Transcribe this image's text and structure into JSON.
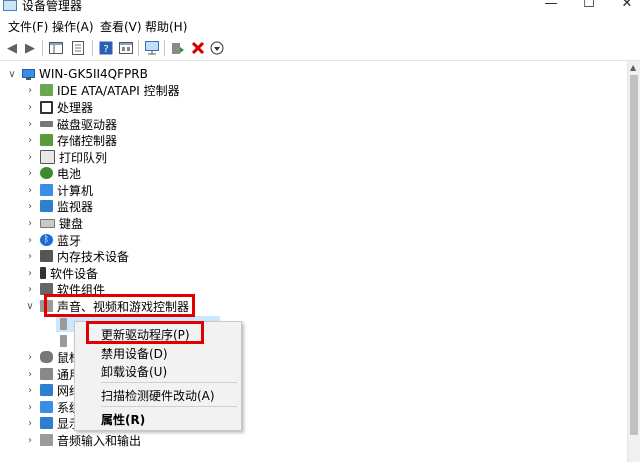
{
  "window": {
    "title": "设备管理器",
    "controls": {
      "minimize": "—",
      "maximize": "☐",
      "close": "✕"
    }
  },
  "menu": [
    "文件(F)",
    "操作(A)",
    "查看(V)",
    "帮助(H)"
  ],
  "tree": {
    "root": "WIN-GK5II4QFPRB",
    "categories": [
      {
        "label": "IDE ATA/ATAPI 控制器",
        "icon": "ide-controller-icon"
      },
      {
        "label": "处理器",
        "icon": "processor-icon"
      },
      {
        "label": "磁盘驱动器",
        "icon": "disk-drive-icon"
      },
      {
        "label": "存储控制器",
        "icon": "storage-controller-icon"
      },
      {
        "label": "打印队列",
        "icon": "printer-icon"
      },
      {
        "label": "电池",
        "icon": "battery-icon"
      },
      {
        "label": "计算机",
        "icon": "computer-icon"
      },
      {
        "label": "监视器",
        "icon": "monitor-icon"
      },
      {
        "label": "键盘",
        "icon": "keyboard-icon"
      },
      {
        "label": "蓝牙",
        "icon": "bluetooth-icon"
      },
      {
        "label": "内存技术设备",
        "icon": "memory-device-icon"
      },
      {
        "label": "软件设备",
        "icon": "software-device-icon"
      },
      {
        "label": "软件组件",
        "icon": "software-component-icon"
      },
      {
        "label": "声音、视频和游戏控制器",
        "icon": "sound-icon"
      }
    ],
    "after_categories": [
      {
        "label": "鼠标",
        "icon": "mouse-icon"
      },
      {
        "label": "通用",
        "icon": "usb-icon"
      },
      {
        "label": "网络",
        "icon": "network-icon"
      },
      {
        "label": "系统",
        "icon": "system-icon"
      },
      {
        "label": "显示",
        "icon": "display-icon"
      },
      {
        "label": "音频输入和输出",
        "icon": "audio-io-icon"
      }
    ]
  },
  "context_menu": {
    "items": [
      "更新驱动程序(P)",
      "禁用设备(D)",
      "卸载设备(U)",
      "扫描检测硬件改动(A)",
      "属性(R)"
    ]
  },
  "colors": {
    "highlight_border": "#e00000",
    "selection_bg": "#cce8ff"
  }
}
